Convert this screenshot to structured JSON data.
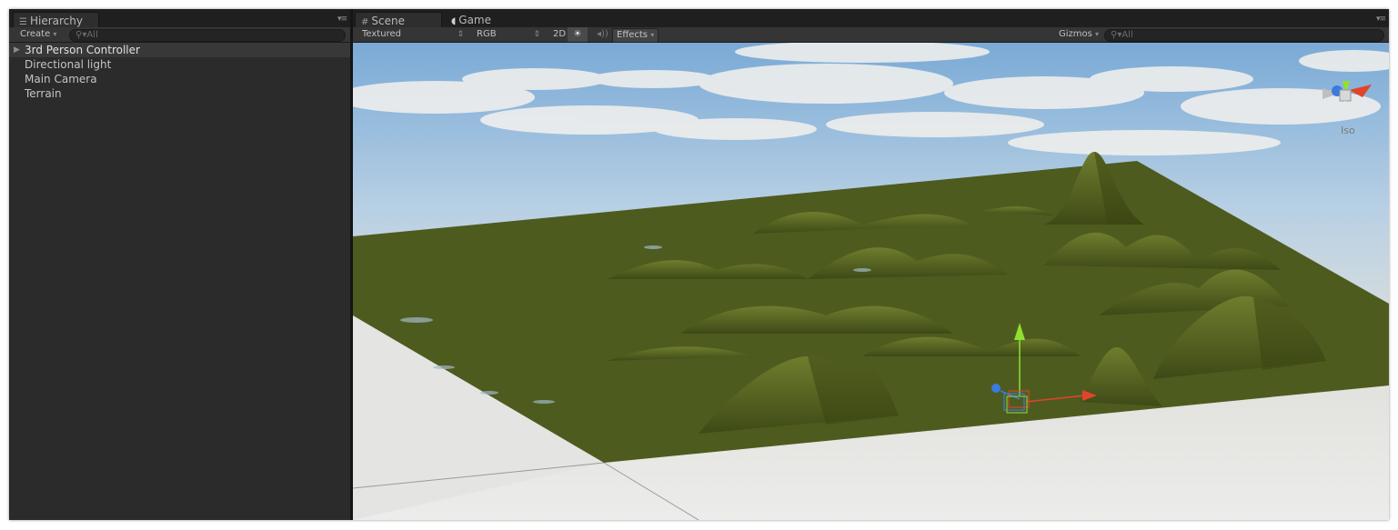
{
  "hierarchy": {
    "tab_label": "Hierarchy",
    "tab_icon": "list-icon",
    "create_label": "Create",
    "search_placeholder": "All",
    "items": [
      {
        "label": "3rd Person Controller",
        "expandable": true,
        "selected": true
      },
      {
        "label": "Directional light"
      },
      {
        "label": "Main Camera"
      },
      {
        "label": "Terrain"
      }
    ]
  },
  "scene": {
    "tabs": [
      {
        "label": "Scene",
        "icon": "grid-icon",
        "active": true
      },
      {
        "label": "Game",
        "icon": "pacman-icon",
        "active": false
      }
    ],
    "toolbar": {
      "render_mode": "Textured",
      "color_mode": "RGB",
      "mode_2d": "2D",
      "lighting_icon": "sun-icon",
      "audio_icon": "speaker-icon",
      "effects_label": "Effects",
      "gizmos_label": "Gizmos",
      "search_placeholder": "All"
    },
    "gizmo": {
      "projection_label": "Iso",
      "axis_colors": {
        "x": "#e0452a",
        "y": "#8fe030",
        "z": "#3a7be0"
      }
    },
    "terrain_color": "#4e5b1f",
    "sky_color": "#9fc4e2"
  }
}
